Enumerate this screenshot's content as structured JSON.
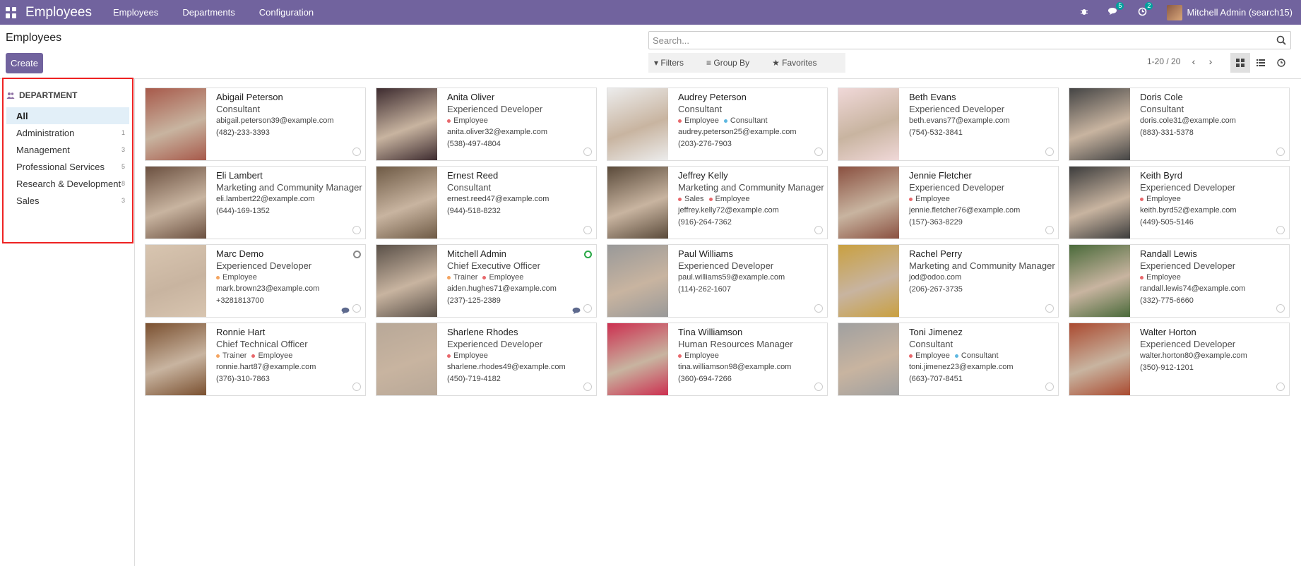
{
  "nav": {
    "app": "Employees",
    "menu": [
      "Employees",
      "Departments",
      "Configuration"
    ],
    "badges": {
      "messages": "5",
      "activities": "2"
    },
    "user": "Mitchell Admin (search15)"
  },
  "cp": {
    "title": "Employees",
    "create": "Create",
    "search_placeholder": "Search...",
    "filters": "Filters",
    "groupby": "Group By",
    "favorites": "Favorites",
    "pager": "1-20 / 20"
  },
  "side": {
    "title": "DEPARTMENT",
    "items": [
      {
        "label": "All",
        "count": ""
      },
      {
        "label": "Administration",
        "count": "1"
      },
      {
        "label": "Management",
        "count": "3"
      },
      {
        "label": "Professional Services",
        "count": "5"
      },
      {
        "label": "Research & Development",
        "count": "8"
      },
      {
        "label": "Sales",
        "count": "3"
      }
    ]
  },
  "employees": [
    {
      "name": "Abigail Peterson",
      "job": "Consultant",
      "tags": [],
      "email": "abigail.peterson39@example.com",
      "phone": "(482)-233-3393"
    },
    {
      "name": "Anita Oliver",
      "job": "Experienced Developer",
      "tags": [
        {
          "label": "Employee",
          "color": "#e8676b"
        }
      ],
      "email": "anita.oliver32@example.com",
      "phone": "(538)-497-4804"
    },
    {
      "name": "Audrey Peterson",
      "job": "Consultant",
      "tags": [
        {
          "label": "Employee",
          "color": "#e8676b"
        },
        {
          "label": "Consultant",
          "color": "#5db7e0"
        }
      ],
      "email": "audrey.peterson25@example.com",
      "phone": "(203)-276-7903"
    },
    {
      "name": "Beth Evans",
      "job": "Experienced Developer",
      "tags": [],
      "email": "beth.evans77@example.com",
      "phone": "(754)-532-3841"
    },
    {
      "name": "Doris Cole",
      "job": "Consultant",
      "tags": [],
      "email": "doris.cole31@example.com",
      "phone": "(883)-331-5378"
    },
    {
      "name": "Eli Lambert",
      "job": "Marketing and Community Manager",
      "tags": [],
      "email": "eli.lambert22@example.com",
      "phone": "(644)-169-1352"
    },
    {
      "name": "Ernest Reed",
      "job": "Consultant",
      "tags": [],
      "email": "ernest.reed47@example.com",
      "phone": "(944)-518-8232"
    },
    {
      "name": "Jeffrey Kelly",
      "job": "Marketing and Community Manager",
      "tags": [
        {
          "label": "Sales",
          "color": "#e8676b"
        },
        {
          "label": "Employee",
          "color": "#e8676b"
        }
      ],
      "email": "jeffrey.kelly72@example.com",
      "phone": "(916)-264-7362"
    },
    {
      "name": "Jennie Fletcher",
      "job": "Experienced Developer",
      "tags": [
        {
          "label": "Employee",
          "color": "#e8676b"
        }
      ],
      "email": "jennie.fletcher76@example.com",
      "phone": "(157)-363-8229"
    },
    {
      "name": "Keith Byrd",
      "job": "Experienced Developer",
      "tags": [
        {
          "label": "Employee",
          "color": "#e8676b"
        }
      ],
      "email": "keith.byrd52@example.com",
      "phone": "(449)-505-5146"
    },
    {
      "name": "Marc Demo",
      "job": "Experienced Developer",
      "tags": [
        {
          "label": "Employee",
          "color": "#f4a460"
        }
      ],
      "email": "mark.brown23@example.com",
      "phone": "+3281813700",
      "status": "grey",
      "chat": true
    },
    {
      "name": "Mitchell Admin",
      "job": "Chief Executive Officer",
      "tags": [
        {
          "label": "Trainer",
          "color": "#f4a460"
        },
        {
          "label": "Employee",
          "color": "#e8676b"
        }
      ],
      "email": "aiden.hughes71@example.com",
      "phone": "(237)-125-2389",
      "status": "green",
      "chat": true
    },
    {
      "name": "Paul Williams",
      "job": "Experienced Developer",
      "tags": [],
      "email": "paul.williams59@example.com",
      "phone": "(114)-262-1607"
    },
    {
      "name": "Rachel Perry",
      "job": "Marketing and Community Manager",
      "tags": [],
      "email": "jod@odoo.com",
      "phone": "(206)-267-3735"
    },
    {
      "name": "Randall Lewis",
      "job": "Experienced Developer",
      "tags": [
        {
          "label": "Employee",
          "color": "#e8676b"
        }
      ],
      "email": "randall.lewis74@example.com",
      "phone": "(332)-775-6660"
    },
    {
      "name": "Ronnie Hart",
      "job": "Chief Technical Officer",
      "tags": [
        {
          "label": "Trainer",
          "color": "#f4a460"
        },
        {
          "label": "Employee",
          "color": "#e8676b"
        }
      ],
      "email": "ronnie.hart87@example.com",
      "phone": "(376)-310-7863"
    },
    {
      "name": "Sharlene Rhodes",
      "job": "Experienced Developer",
      "tags": [
        {
          "label": "Employee",
          "color": "#e8676b"
        }
      ],
      "email": "sharlene.rhodes49@example.com",
      "phone": "(450)-719-4182"
    },
    {
      "name": "Tina Williamson",
      "job": "Human Resources Manager",
      "tags": [
        {
          "label": "Employee",
          "color": "#e8676b"
        }
      ],
      "email": "tina.williamson98@example.com",
      "phone": "(360)-694-7266"
    },
    {
      "name": "Toni Jimenez",
      "job": "Consultant",
      "tags": [
        {
          "label": "Employee",
          "color": "#e8676b"
        },
        {
          "label": "Consultant",
          "color": "#5db7e0"
        }
      ],
      "email": "toni.jimenez23@example.com",
      "phone": "(663)-707-8451"
    },
    {
      "name": "Walter Horton",
      "job": "Experienced Developer",
      "tags": [],
      "email": "walter.horton80@example.com",
      "phone": "(350)-912-1201"
    }
  ],
  "photo_colors": [
    "#a7594a",
    "#3d2b2f",
    "#ececec",
    "#f0d8d8",
    "#444",
    "#6b5040",
    "#6e5a45",
    "#5a4a3a",
    "#8a5040",
    "#3c3c3c",
    "#d8c5b0",
    "#5a5048",
    "#999",
    "#c9a040",
    "#4a6a3a",
    "#7a5030",
    "#b8a898",
    "#cc3050",
    "#a0a0a0",
    "#aa4a30"
  ]
}
